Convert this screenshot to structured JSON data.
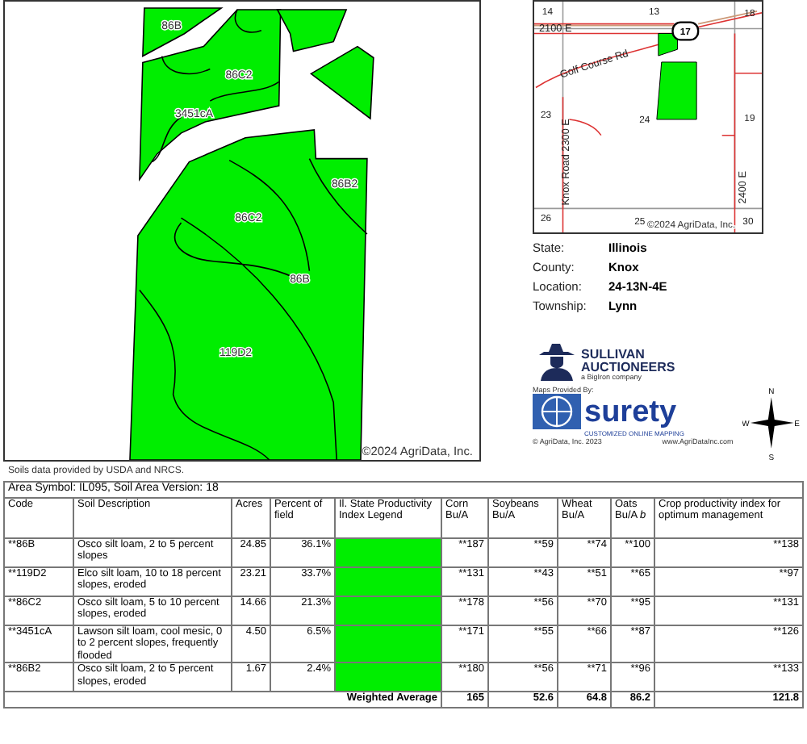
{
  "field_map": {
    "labels": [
      "86B",
      "86C2",
      "3451cA",
      "86B2",
      "86C2",
      "86B",
      "119D2"
    ],
    "copyright": "©2024 AgriData, Inc."
  },
  "locator_map": {
    "labels": [
      "14",
      "13",
      "18",
      "2100 E",
      "Golf Course Rd",
      "23",
      "24",
      "19",
      "Knox Road 2300 E",
      "2400 E",
      "26",
      "25",
      "30"
    ],
    "route_shield": "17",
    "copyright": "©2024 AgriData, Inc."
  },
  "location_info": [
    {
      "label": "State:",
      "value": "Illinois"
    },
    {
      "label": "County:",
      "value": "Knox"
    },
    {
      "label": "Location:",
      "value": "24-13N-4E"
    },
    {
      "label": "Township:",
      "value": "Lynn"
    }
  ],
  "sponsor_logo": {
    "name_line_1": "SULLIVAN",
    "name_line_2": "AUCTIONEERS",
    "tagline": "a BigIron company"
  },
  "map_provider": {
    "caption": "Maps Provided By:",
    "brand": "surety",
    "slogan": "CUSTOMIZED ONLINE MAPPING",
    "copyright": "© AgriData, Inc. 2023",
    "website": "www.AgriDataInc.com"
  },
  "compass": {
    "north": "N",
    "south": "S",
    "east": "E",
    "west": "W"
  },
  "source_note": "Soils data provided by USDA and NRCS.",
  "soil_table": {
    "title": "Area Symbol: IL095, Soil Area Version: 18",
    "columns": [
      "Code",
      "Soil Description",
      "Acres",
      "Percent of field",
      "Il. State Productivity Index Legend",
      "Corn Bu/A",
      "Soybeans Bu/A",
      "Wheat Bu/A",
      "Oats Bu/A *b*",
      "Crop productivity index for optimum management"
    ],
    "rows": [
      {
        "code": "**86B",
        "description": "Osco silt loam, 2 to 5 percent slopes",
        "acres": "24.85",
        "percent": "36.1%",
        "corn": "**187",
        "soybeans": "**59",
        "wheat": "**74",
        "oats": "**100",
        "cpi": "**138"
      },
      {
        "code": "**119D2",
        "description": "Elco silt loam, 10 to 18 percent slopes, eroded",
        "acres": "23.21",
        "percent": "33.7%",
        "corn": "**131",
        "soybeans": "**43",
        "wheat": "**51",
        "oats": "**65",
        "cpi": "**97"
      },
      {
        "code": "**86C2",
        "description": "Osco silt loam, 5 to 10 percent slopes, eroded",
        "acres": "14.66",
        "percent": "21.3%",
        "corn": "**178",
        "soybeans": "**56",
        "wheat": "**70",
        "oats": "**95",
        "cpi": "**131"
      },
      {
        "code": "**3451cA",
        "description": "Lawson silt loam, cool mesic, 0 to 2 percent slopes, frequently flooded",
        "acres": "4.50",
        "percent": "6.5%",
        "corn": "**171",
        "soybeans": "**55",
        "wheat": "**66",
        "oats": "**87",
        "cpi": "**126"
      },
      {
        "code": "**86B2",
        "description": "Osco silt loam, 2 to 5 percent slopes, eroded",
        "acres": "1.67",
        "percent": "2.4%",
        "corn": "**180",
        "soybeans": "**56",
        "wheat": "**71",
        "oats": "**96",
        "cpi": "**133"
      }
    ],
    "footer": {
      "label": "Weighted Average",
      "corn": "165",
      "soybeans": "52.6",
      "wheat": "64.8",
      "oats": "86.2",
      "cpi": "121.8"
    }
  }
}
